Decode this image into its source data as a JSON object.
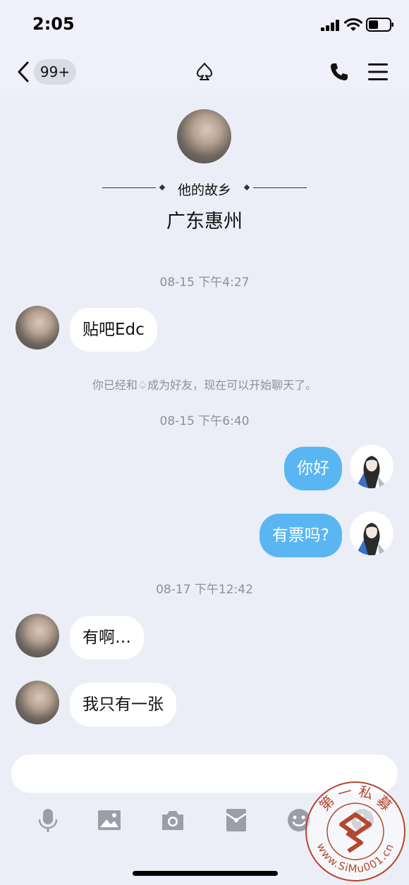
{
  "status_bar": {
    "time": "2:05"
  },
  "header": {
    "unread_badge": "99+",
    "title_icon": "spade-outline-icon",
    "call_icon": "phone-icon",
    "menu_icon": "hamburger-menu-icon"
  },
  "profile": {
    "section_label": "他的故乡",
    "hometown": "广东惠州"
  },
  "messages": {
    "time1": "08-15 下午4:27",
    "msg1": "贴吧Edc",
    "system_notice": "你已经和♤成为好友，现在可以开始聊天了。",
    "time2": "08-15 下午6:40",
    "msg2": "你好",
    "msg3": "有票吗?",
    "time3": "08-17 下午12:42",
    "msg4": "有啊…",
    "msg5": "我只有一张"
  },
  "toolbar": {
    "icons": [
      "microphone-icon",
      "image-icon",
      "camera-icon",
      "red-packet-icon",
      "emoji-icon",
      "plus-icon"
    ]
  },
  "watermark": {
    "text": "第 一 私 募",
    "url": "www.SiMu001.cn"
  },
  "colors": {
    "outgoing_bubble": "#5ab6f2",
    "background": "#eceef7",
    "watermark": "#b3472f"
  }
}
